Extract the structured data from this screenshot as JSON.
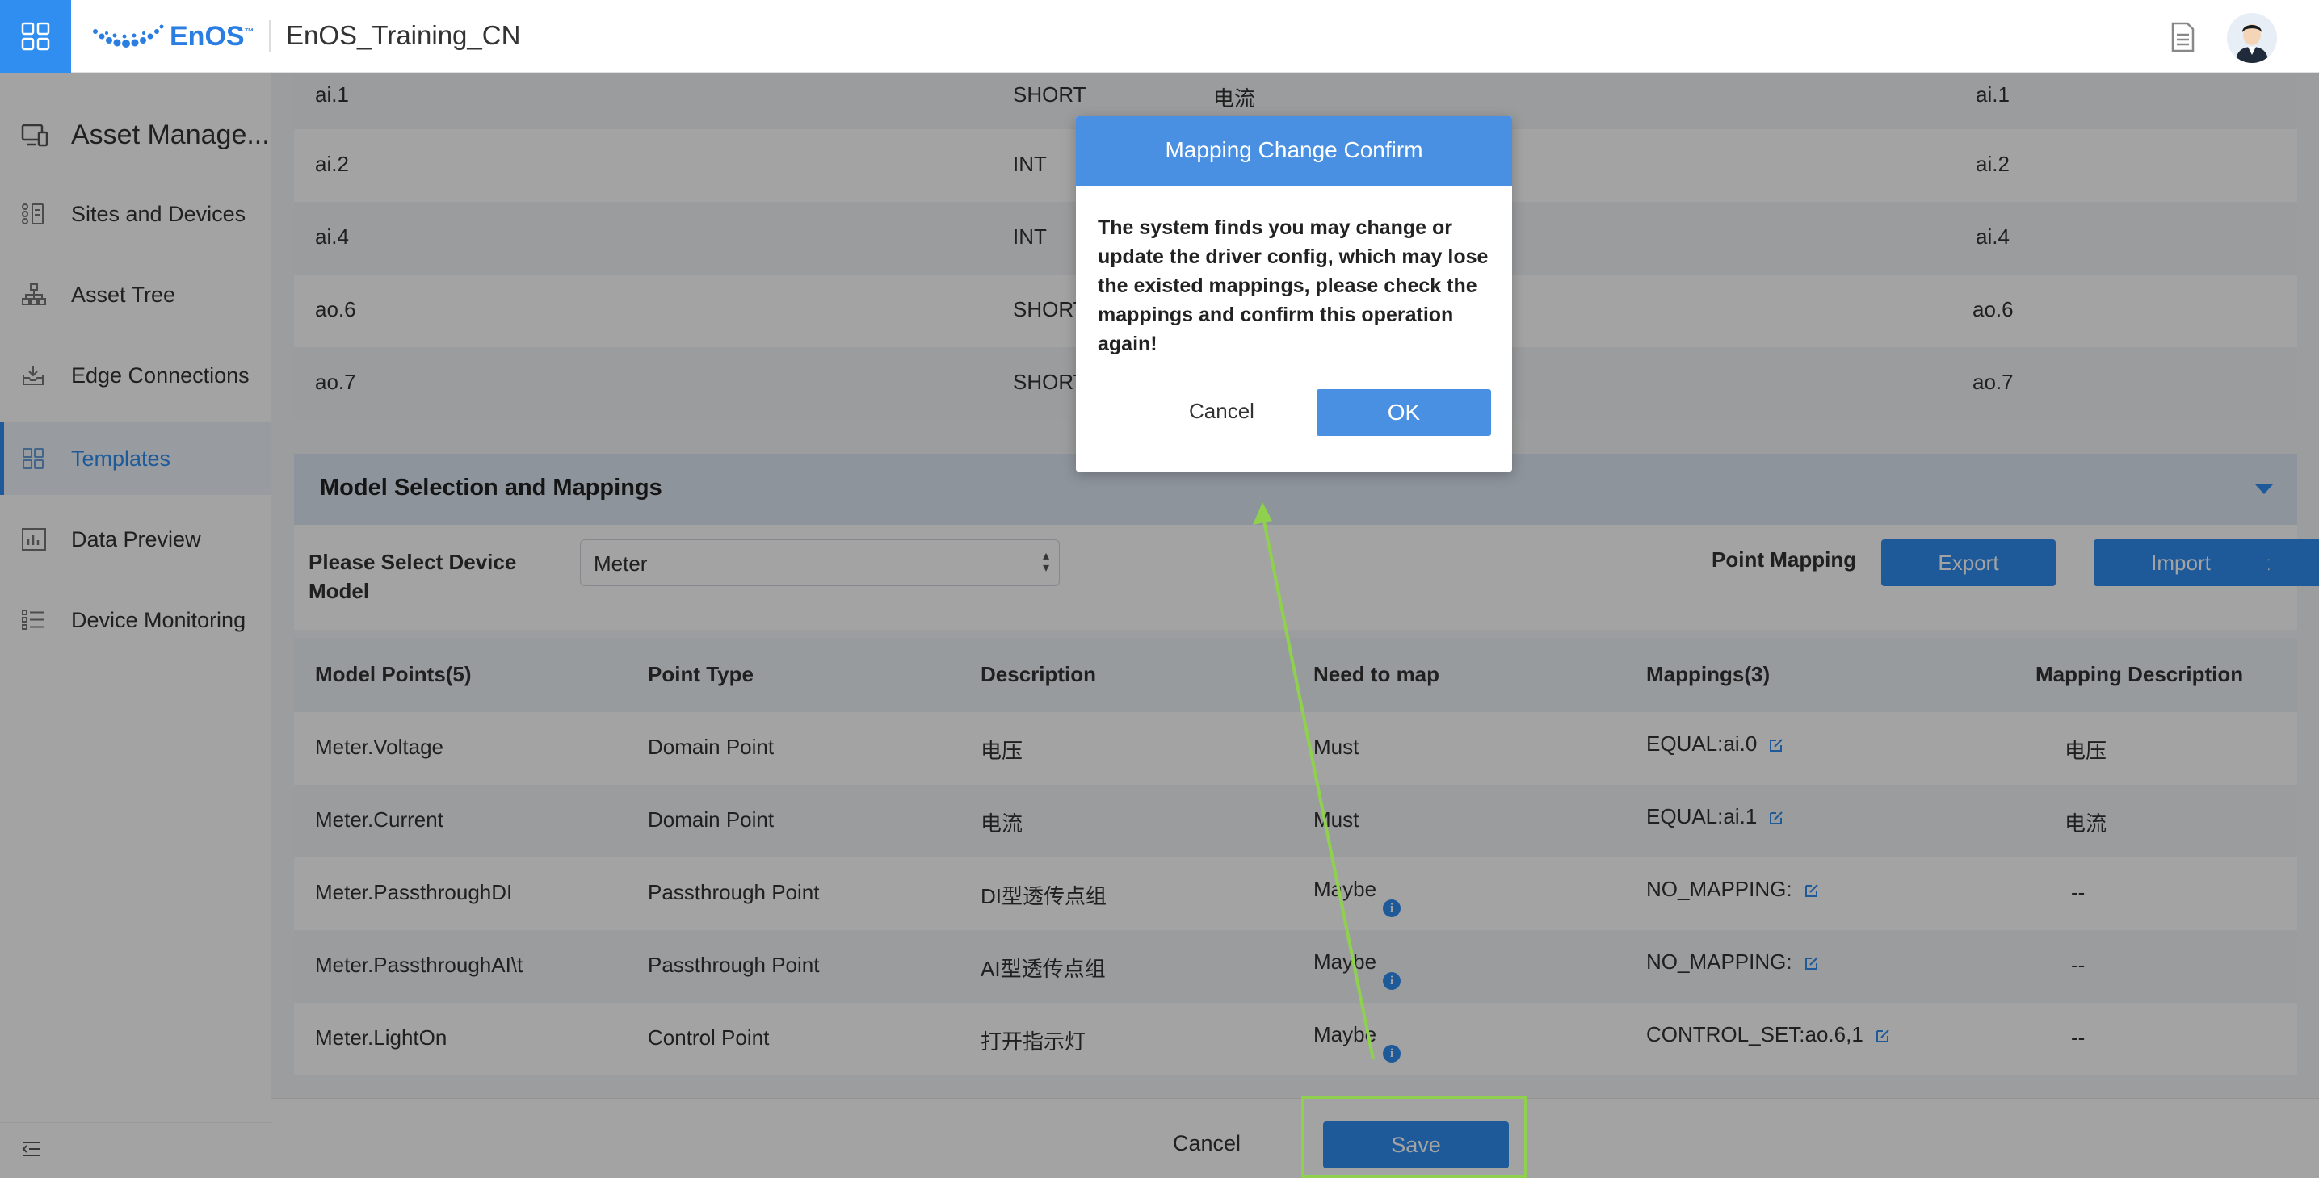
{
  "header": {
    "logo_text_en": "En",
    "logo_text_os": "OS",
    "logo_tm": "™",
    "app_title": "EnOS_Training_CN"
  },
  "sidebar": {
    "section_title": "Asset Manage...",
    "items": [
      {
        "label": "Sites and Devices",
        "icon": "sites-icon"
      },
      {
        "label": "Asset Tree",
        "icon": "tree-icon"
      },
      {
        "label": "Edge Connections",
        "icon": "edge-icon"
      },
      {
        "label": "Templates",
        "icon": "templates-icon",
        "active": true
      },
      {
        "label": "Data Preview",
        "icon": "chart-icon"
      },
      {
        "label": "Device Monitoring",
        "icon": "monitor-icon"
      }
    ]
  },
  "upper_rows": [
    {
      "name": "ai.1",
      "type": "SHORT",
      "desc": "电流",
      "map": "ai.1"
    },
    {
      "name": "ai.2",
      "type": "INT",
      "desc": "",
      "map": "ai.2"
    },
    {
      "name": "ai.4",
      "type": "INT",
      "desc": "",
      "map": "ai.4"
    },
    {
      "name": "ao.6",
      "type": "SHORT",
      "desc": "",
      "map": "ao.6"
    },
    {
      "name": "ao.7",
      "type": "SHORT",
      "desc": "",
      "map": "ao.7"
    }
  ],
  "section": {
    "title": "Model Selection and Mappings"
  },
  "model_select": {
    "label": "Please Select Device Model",
    "value": "Meter",
    "point_mapping_label": "Point Mapping",
    "export_label": "Export",
    "import_label": "Import"
  },
  "table": {
    "headers": [
      "Model Points(5)",
      "Point Type",
      "Description",
      "Need to map",
      "Mappings(3)",
      "Mapping Description"
    ],
    "rows": [
      {
        "point": "Meter.Voltage",
        "type": "Domain Point",
        "desc": "电压",
        "need": "Must",
        "mapping": "EQUAL:ai.0",
        "mdesc": "电压"
      },
      {
        "point": "Meter.Current",
        "type": "Domain Point",
        "desc": "电流",
        "need": "Must",
        "mapping": "EQUAL:ai.1",
        "mdesc": "电流"
      },
      {
        "point": "Meter.PassthroughDI",
        "type": "Passthrough Point",
        "desc": "DI型透传点组",
        "need": "Maybe",
        "mapping": "NO_MAPPING:",
        "mdesc": "--"
      },
      {
        "point": "Meter.PassthroughAI\\t",
        "type": "Passthrough Point",
        "desc": "AI型透传点组",
        "need": "Maybe",
        "mapping": "NO_MAPPING:",
        "mdesc": "--"
      },
      {
        "point": "Meter.LightOn",
        "type": "Control Point",
        "desc": "打开指示灯",
        "need": "Maybe",
        "mapping": "CONTROL_SET:ao.6,1",
        "mdesc": "--"
      }
    ]
  },
  "footer": {
    "cancel_label": "Cancel",
    "save_label": "Save"
  },
  "modal": {
    "title": "Mapping Change Confirm",
    "message": "The system finds you may change or update the driver config, which may lose the existed mappings, please check the mappings and confirm this operation again!",
    "cancel_label": "Cancel",
    "ok_label": "OK"
  },
  "colors": {
    "accent": "#2f8ef0",
    "modal_header": "#4a90e2",
    "annotation": "#8fd14f"
  }
}
